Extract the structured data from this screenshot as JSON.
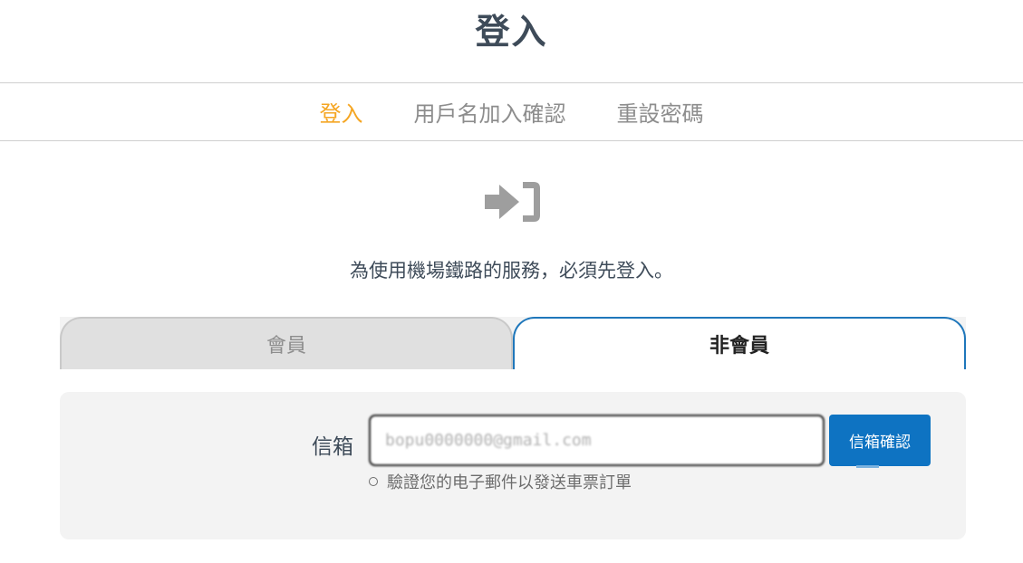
{
  "page": {
    "title": "登入"
  },
  "nav_tabs": [
    {
      "label": "登入",
      "active": true
    },
    {
      "label": "用戶名加入確認",
      "active": false
    },
    {
      "label": "重設密碼",
      "active": false
    }
  ],
  "icon": "sign-in-icon",
  "notice": "為使用機場鐵路的服務，必須先登入。",
  "member_tabs": {
    "member": "會員",
    "non_member": "非會員",
    "selected": "非會員"
  },
  "form": {
    "email_label": "信箱",
    "email_value": "bopu0000000@gmail.com",
    "verify_button": "信箱確認",
    "hint": "驗證您的电子郵件以發送車票訂單"
  },
  "colors": {
    "accent_active_tab": "#f5a623",
    "primary_button": "#0e73c2",
    "selected_tab_border": "#1f77bb"
  }
}
